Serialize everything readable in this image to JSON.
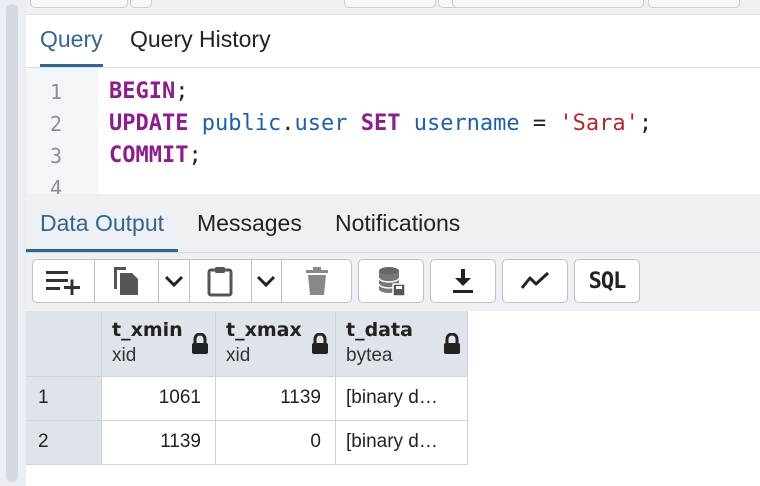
{
  "query_tabs": [
    {
      "label": "Query",
      "active": true
    },
    {
      "label": "Query History",
      "active": false
    }
  ],
  "editor": {
    "line_numbers": [
      "1",
      "2",
      "3",
      "4"
    ],
    "lines": [
      [
        {
          "t": "BEGIN",
          "c": "kw"
        },
        {
          "t": ";",
          "c": "plain"
        }
      ],
      [
        {
          "t": "UPDATE",
          "c": "kw"
        },
        {
          "t": " ",
          "c": "plain"
        },
        {
          "t": "public",
          "c": "id"
        },
        {
          "t": ".",
          "c": "plain"
        },
        {
          "t": "user",
          "c": "id"
        },
        {
          "t": " ",
          "c": "plain"
        },
        {
          "t": "SET",
          "c": "kw"
        },
        {
          "t": " ",
          "c": "plain"
        },
        {
          "t": "username",
          "c": "id"
        },
        {
          "t": " = ",
          "c": "plain"
        },
        {
          "t": "'Sara'",
          "c": "str"
        },
        {
          "t": ";",
          "c": "plain"
        }
      ],
      [
        {
          "t": "COMMIT",
          "c": "kw"
        },
        {
          "t": ";",
          "c": "plain"
        }
      ],
      []
    ]
  },
  "output_tabs": [
    {
      "label": "Data Output",
      "active": true
    },
    {
      "label": "Messages",
      "active": false
    },
    {
      "label": "Notifications",
      "active": false
    }
  ],
  "toolbar": {
    "buttons": [
      "add-row-icon",
      "copy-icon",
      "chevron-down-icon",
      "paste-icon",
      "chevron-down-icon",
      "delete-icon",
      "save-data-icon",
      "download-icon",
      "graph-icon",
      "sql-icon"
    ],
    "sql_label": "SQL"
  },
  "grid": {
    "columns": [
      {
        "name": "t_xmin",
        "type": "xid"
      },
      {
        "name": "t_xmax",
        "type": "xid"
      },
      {
        "name": "t_data",
        "type": "bytea"
      }
    ],
    "rows": [
      {
        "num": "1",
        "cells": [
          "1061",
          "1139",
          "[binary d…"
        ]
      },
      {
        "num": "2",
        "cells": [
          "1139",
          "0",
          "[binary d…"
        ]
      }
    ]
  },
  "colors": {
    "accent": "#326690",
    "keyword": "#8b1e8b",
    "identifier": "#1f5fa8",
    "string": "#b0282b"
  }
}
